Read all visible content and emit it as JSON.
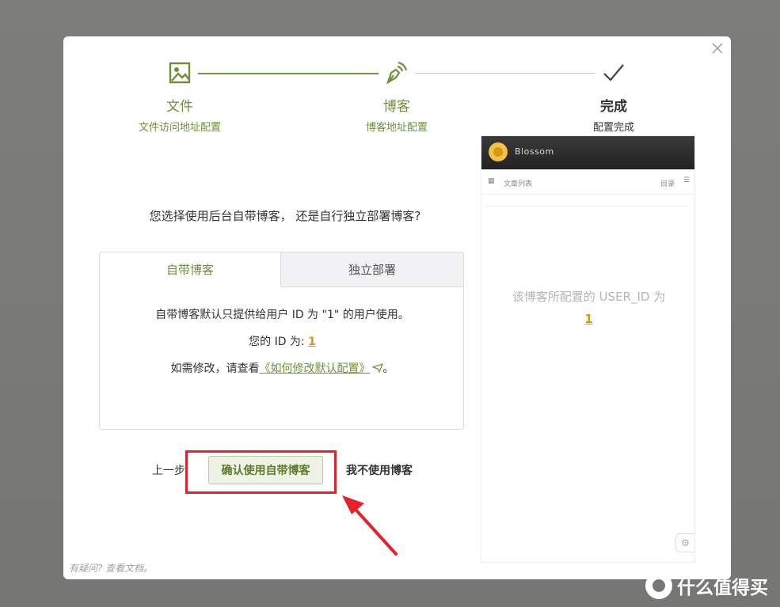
{
  "steps": [
    {
      "title": "文件",
      "subtitle": "文件访问地址配置",
      "icon": "image-icon"
    },
    {
      "title": "博客",
      "subtitle": "博客地址配置",
      "icon": "pen-nib-icon"
    },
    {
      "title": "完成",
      "subtitle": "配置完成",
      "icon": "check-icon"
    }
  ],
  "question": "您选择使用后台自带博客， 还是自行独立部署博客?",
  "tabs": {
    "builtin": "自带博客",
    "standalone": "独立部署"
  },
  "tab_content": {
    "line1": "自带博客默认只提供给用户 ID 为 \"1\" 的用户使用。",
    "id_label": "您的 ID 为:",
    "id_value": "1",
    "line3_prefix": "如需修改，请查看",
    "doc_link": "《如何修改默认配置》",
    "line3_suffix": "。"
  },
  "actions": {
    "prev": "上一步",
    "confirm": "确认使用自带博客",
    "no_blog": "我不使用博客"
  },
  "help": "有疑问? 查看文档。",
  "preview": {
    "blog_name": "Blossom",
    "article_list": "文章列表",
    "toc": "目录",
    "message": "该博客所配置的 USER_ID 为",
    "user_id": "1"
  },
  "watermark": "什么值得买",
  "colors": {
    "accent": "#6f8f3a",
    "highlight": "#d59a0b",
    "annotation_red": "#e8202a"
  }
}
